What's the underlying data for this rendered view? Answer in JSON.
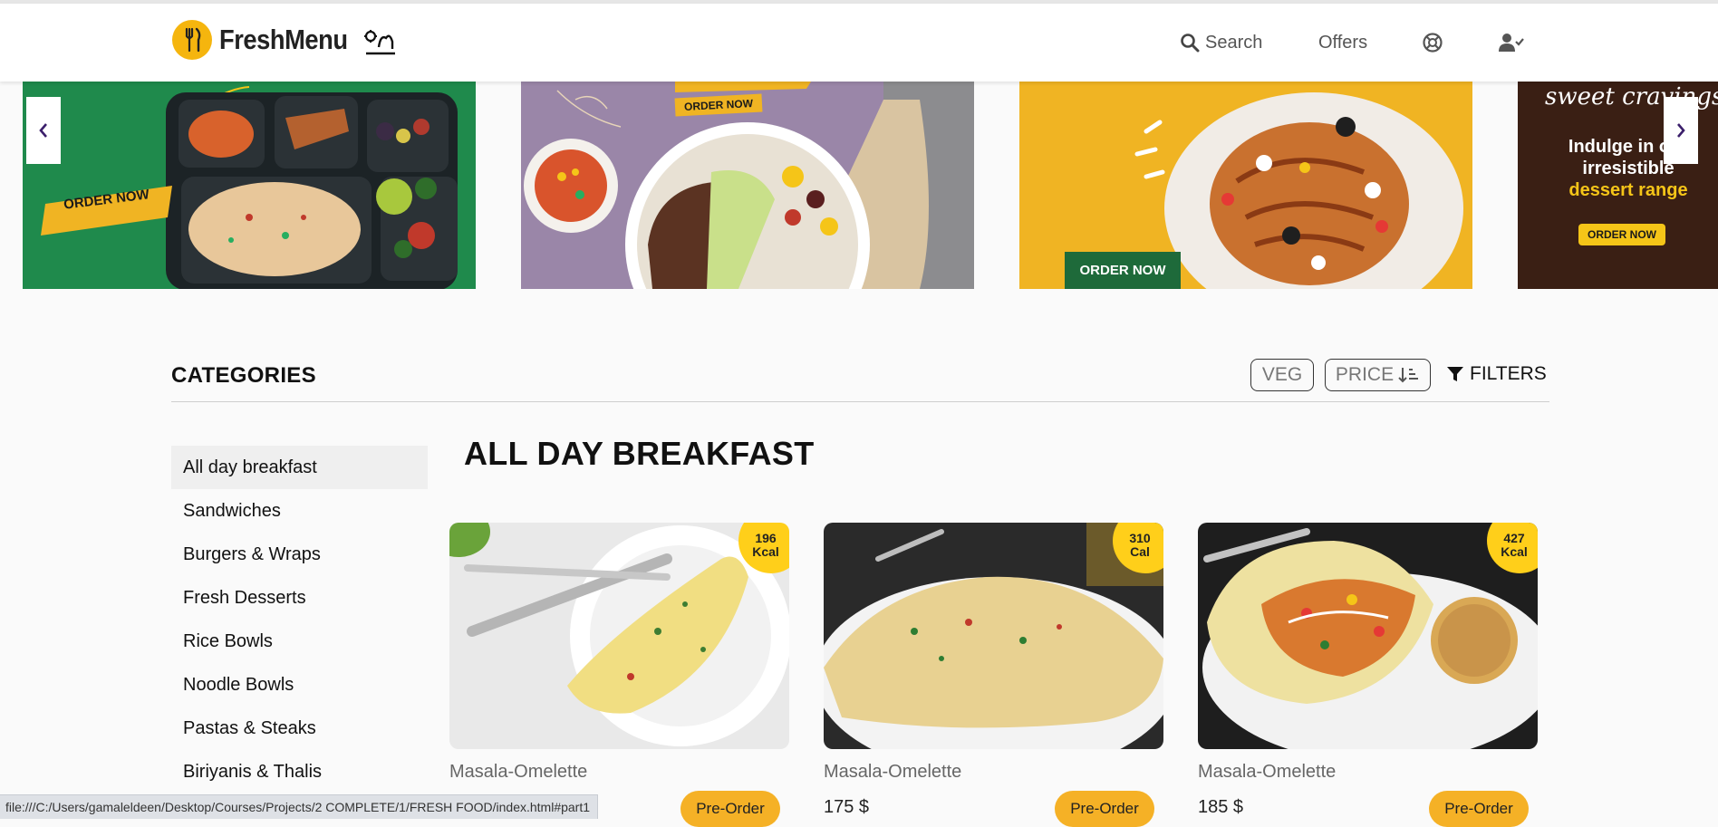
{
  "header": {
    "logo_text": "FreshMenu",
    "nav": {
      "search": "Search",
      "offers": "Offers"
    }
  },
  "carousel": {
    "slides": [
      {
        "badge": "ORDER NOW"
      },
      {
        "badge": "ORDER NOW"
      },
      {
        "badge": "ORDER NOW"
      },
      {
        "headline": "sweet cravings?",
        "text_lines": [
          "Indulge in our",
          "irresistible"
        ],
        "highlight": "dessert range",
        "badge": "ORDER NOW"
      }
    ]
  },
  "categories": {
    "title": "CATEGORIES",
    "veg_label": "VEG",
    "price_label": "PRICE",
    "filters_label": "FILTERS"
  },
  "sidebar": {
    "items": [
      "All day breakfast",
      "Sandwiches",
      "Burgers & Wraps",
      "Fresh Desserts",
      "Rice Bowls",
      "Noodle Bowls",
      "Pastas & Steaks",
      "Biriyanis & Thalis"
    ]
  },
  "section": {
    "title": "ALL DAY BREAKFAST"
  },
  "products": [
    {
      "name": "Masala-Omelette",
      "price": "",
      "kcal": "196\nKcal",
      "button": "Pre-Order"
    },
    {
      "name": "Masala-Omelette",
      "price": "175 $",
      "kcal": "310\nCal",
      "button": "Pre-Order"
    },
    {
      "name": "Masala-Omelette",
      "price": "185 $",
      "kcal": "427\nKcal",
      "button": "Pre-Order"
    }
  ],
  "statusbar": {
    "url": "file:///C:/Users/gamaleldeen/Desktop/Courses/Projects/2 COMPLETE/1/FRESH FOOD/index.html#part1"
  },
  "colors": {
    "brand_yellow": "#f5b50e",
    "button_orange": "#f5b126",
    "slide1_green": "#1f8a4c",
    "slide2_purple": "#9a86a8",
    "slide3_yellow": "#f0b423"
  }
}
